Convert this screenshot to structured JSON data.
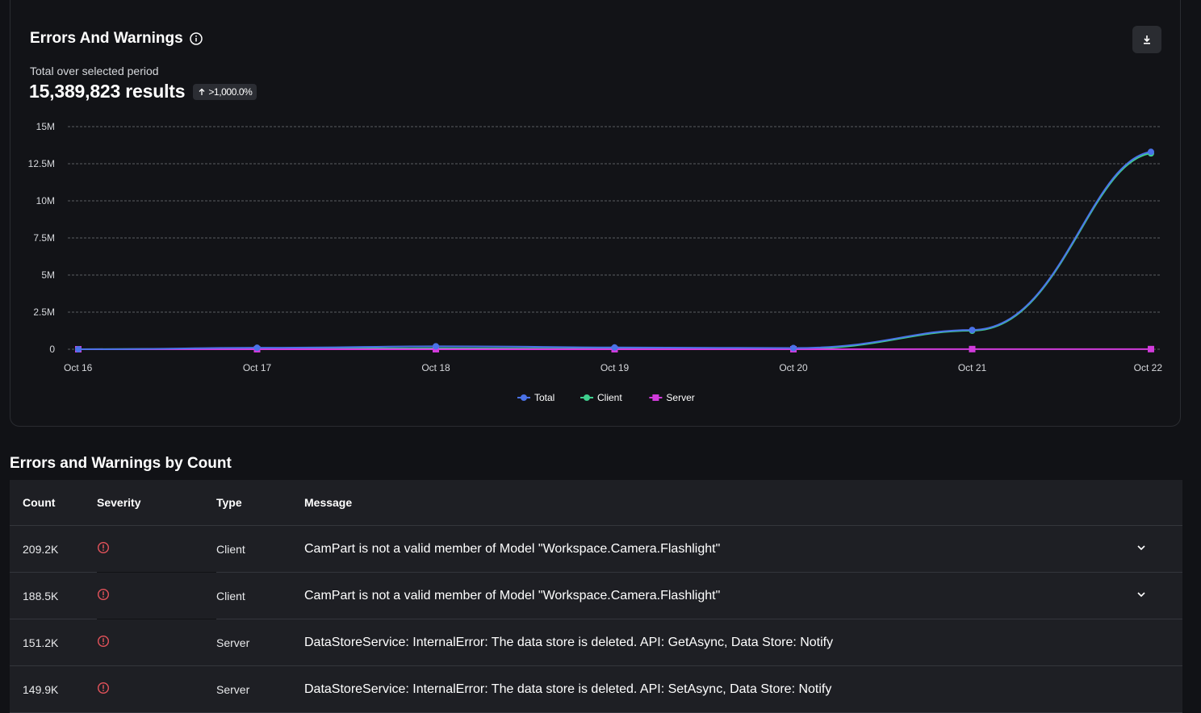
{
  "card": {
    "title": "Errors And Warnings",
    "subtitle": "Total over selected period",
    "total": "15,389,823 results",
    "change": ">1,000.0%",
    "icons": {
      "info": "info-icon",
      "download": "download-icon",
      "change": "arrow-up-icon"
    }
  },
  "chart_data": {
    "type": "line",
    "categories": [
      "Oct 16",
      "Oct 17",
      "Oct 18",
      "Oct 19",
      "Oct 20",
      "Oct 21",
      "Oct 22"
    ],
    "y_ticks": [
      "0",
      "2.5M",
      "5M",
      "7.5M",
      "10M",
      "12.5M",
      "15M"
    ],
    "ylim": [
      0,
      15000000
    ],
    "grid": true,
    "legend_position": "bottom",
    "series": [
      {
        "name": "Total",
        "color": "#4a72e8",
        "marker": "circle",
        "values": [
          0,
          100000,
          200000,
          120000,
          80000,
          1300000,
          13300000
        ]
      },
      {
        "name": "Client",
        "color": "#3fcf8e",
        "marker": "circle",
        "values": [
          0,
          40000,
          60000,
          30000,
          20000,
          1250000,
          13200000
        ]
      },
      {
        "name": "Server",
        "color": "#d13bdb",
        "marker": "square",
        "values": [
          0,
          0,
          0,
          0,
          0,
          10000,
          10000
        ]
      }
    ]
  },
  "table": {
    "title": "Errors and Warnings by Count",
    "headers": {
      "count": "Count",
      "severity": "Severity",
      "type": "Type",
      "message": "Message"
    },
    "rows": [
      {
        "count": "209.2K",
        "severity": "error-icon",
        "type": "Client",
        "message": "CamPart is not a valid member of Model \"Workspace.Camera.Flashlight\"",
        "expandable": true
      },
      {
        "count": "188.5K",
        "severity": "error-icon",
        "type": "Client",
        "message": "CamPart is not a valid member of Model \"Workspace.Camera.Flashlight\"",
        "expandable": true
      },
      {
        "count": "151.2K",
        "severity": "error-icon",
        "type": "Server",
        "message": "DataStoreService: InternalError: The data store is deleted. API: GetAsync, Data Store: Notify",
        "expandable": false
      },
      {
        "count": "149.9K",
        "severity": "error-icon",
        "type": "Server",
        "message": "DataStoreService: InternalError: The data store is deleted. API: SetAsync, Data Store: Notify",
        "expandable": false
      }
    ]
  }
}
